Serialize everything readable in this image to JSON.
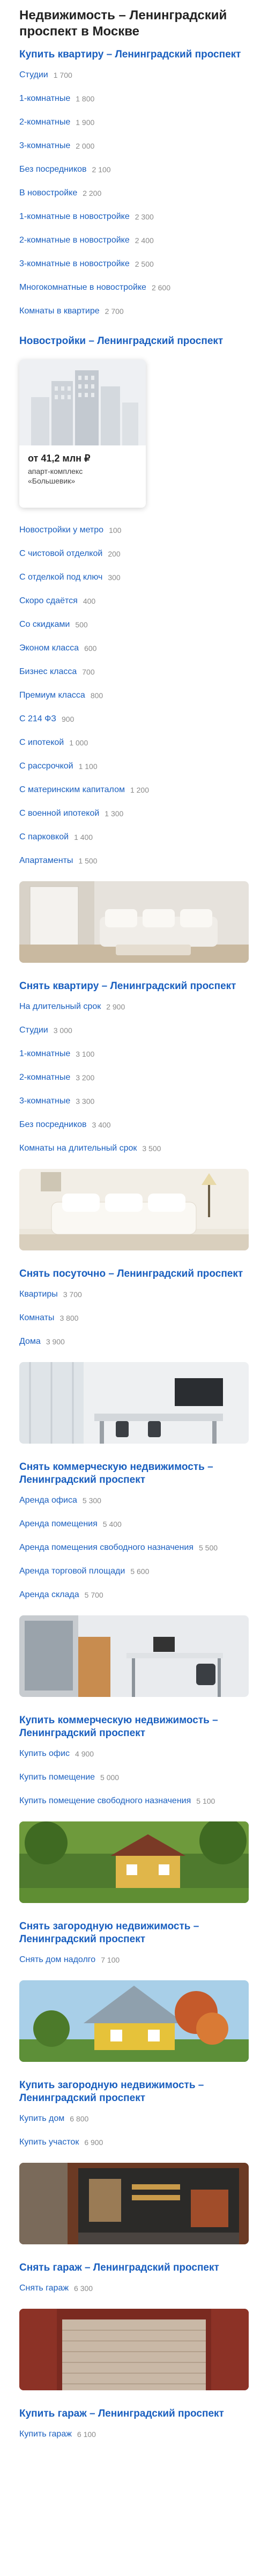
{
  "page": {
    "title": "Недвижимость – Ленинградский проспект в Москве"
  },
  "sections": {
    "buy_apartment": {
      "title": "Купить квартиру – Ленинградский проспект",
      "items": [
        {
          "label": "Студии",
          "count": "1 700"
        },
        {
          "label": "1-комнатные",
          "count": "1 800"
        },
        {
          "label": "2-комнатные",
          "count": "1 900"
        },
        {
          "label": "3-комнатные",
          "count": "2 000"
        },
        {
          "label": "Без посредников",
          "count": "2 100"
        },
        {
          "label": "В новостройке",
          "count": "2 200"
        },
        {
          "label": "1-комнатные в новостройке",
          "count": "2 300"
        },
        {
          "label": "2-комнатные в новостройке",
          "count": "2 400"
        },
        {
          "label": "3-комнатные в новостройке",
          "count": "2 500"
        },
        {
          "label": "Многокомнатные в новостройке",
          "count": "2 600"
        },
        {
          "label": "Комнаты в квартире",
          "count": "2 700"
        }
      ]
    },
    "new_buildings": {
      "title": "Новостройки – Ленинградский проспект",
      "card": {
        "price": "от 41,2 млн ₽",
        "line1": "апарт-комплекс",
        "line2": "«Большевик»"
      },
      "items": [
        {
          "label": "Новостройки у метро",
          "count": "100"
        },
        {
          "label": "С чистовой отделкой",
          "count": "200"
        },
        {
          "label": "С отделкой под ключ",
          "count": "300"
        },
        {
          "label": "Скоро сдаётся",
          "count": "400"
        },
        {
          "label": "Со скидками",
          "count": "500"
        },
        {
          "label": "Эконом класса",
          "count": "600"
        },
        {
          "label": "Бизнес класса",
          "count": "700"
        },
        {
          "label": "Премиум класса",
          "count": "800"
        },
        {
          "label": "С 214 ФЗ",
          "count": "900"
        },
        {
          "label": "С ипотекой",
          "count": "1 000"
        },
        {
          "label": "С рассрочкой",
          "count": "1 100"
        },
        {
          "label": "С материнским капиталом",
          "count": "1 200"
        },
        {
          "label": "С военной ипотекой",
          "count": "1 300"
        },
        {
          "label": "С парковкой",
          "count": "1 400"
        },
        {
          "label": "Апартаменты",
          "count": "1 500"
        }
      ]
    },
    "rent_apartment": {
      "title": "Снять квартиру – Ленинградский проспект",
      "items": [
        {
          "label": "На длительный срок",
          "count": "2 900"
        },
        {
          "label": "Студии",
          "count": "3 000"
        },
        {
          "label": "1-комнатные",
          "count": "3 100"
        },
        {
          "label": "2-комнатные",
          "count": "3 200"
        },
        {
          "label": "3-комнатные",
          "count": "3 300"
        },
        {
          "label": "Без посредников",
          "count": "3 400"
        },
        {
          "label": "Комнаты на длительный срок",
          "count": "3 500"
        }
      ]
    },
    "rent_daily": {
      "title": "Снять посуточно – Ленинградский проспект",
      "items": [
        {
          "label": "Квартиры",
          "count": "3 700"
        },
        {
          "label": "Комнаты",
          "count": "3 800"
        },
        {
          "label": "Дома",
          "count": "3 900"
        }
      ]
    },
    "rent_commercial": {
      "title": "Снять коммерческую недвижимость – Ленинградский проспект",
      "items": [
        {
          "label": "Аренда офиса",
          "count": "5 300"
        },
        {
          "label": "Аренда помещения",
          "count": "5 400"
        },
        {
          "label": "Аренда помещения свободного назначения",
          "count": "5 500"
        },
        {
          "label": "Аренда торговой площади",
          "count": "5 600"
        },
        {
          "label": "Аренда склада",
          "count": "5 700"
        }
      ]
    },
    "buy_commercial": {
      "title": "Купить коммерческую недвижимость – Ленинградский проспект",
      "items": [
        {
          "label": "Купить офис",
          "count": "4 900"
        },
        {
          "label": "Купить помещение",
          "count": "5 000"
        },
        {
          "label": "Купить помещение свободного назначения",
          "count": "5 100"
        }
      ]
    },
    "rent_country": {
      "title": "Снять загородную недвижимость – Ленинградский проспект",
      "items": [
        {
          "label": "Снять дом надолго",
          "count": "7 100"
        }
      ]
    },
    "buy_country": {
      "title": "Купить загородную недвижимость – Ленинградский проспект",
      "items": [
        {
          "label": "Купить дом",
          "count": "6 800"
        },
        {
          "label": "Купить участок",
          "count": "6 900"
        }
      ]
    },
    "rent_garage": {
      "title": "Снять гараж – Ленинградский проспект",
      "items": [
        {
          "label": "Снять гараж",
          "count": "6 300"
        }
      ]
    },
    "buy_garage": {
      "title": "Купить гараж – Ленинградский проспект",
      "items": [
        {
          "label": "Купить гараж",
          "count": "6 100"
        }
      ]
    }
  },
  "colors": {
    "link": "#1a5fbf",
    "count": "#8a8a8a",
    "title": "#222222"
  }
}
